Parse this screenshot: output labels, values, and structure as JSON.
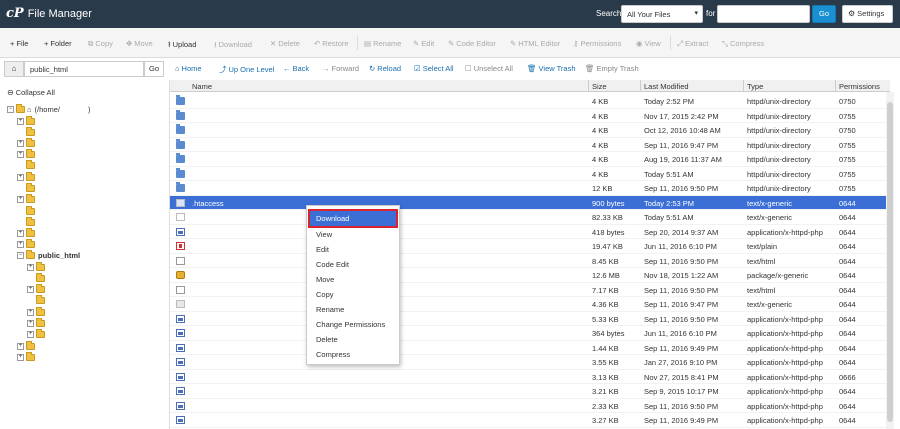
{
  "header": {
    "title": "File Manager",
    "logo": "cP",
    "search_label": "Search",
    "search_scope": "All Your Files",
    "for_label": "for",
    "search_value": "",
    "go_label": "Go",
    "settings_label": "Settings"
  },
  "toolbar": {
    "file": "File",
    "folder": "Folder",
    "copy": "Copy",
    "move": "Move",
    "upload": "Upload",
    "download": "Download",
    "delete": "Delete",
    "restore": "Restore",
    "rename": "Rename",
    "edit": "Edit",
    "code_editor": "Code Editor",
    "html_editor": "HTML Editor",
    "permissions": "Permissions",
    "view": "View",
    "extract": "Extract",
    "compress": "Compress"
  },
  "nav": {
    "path_value": "public_html",
    "go_label": "Go",
    "collapse_all": "Collapse All",
    "root_label": "(/home/",
    "root_suffix": ")",
    "public_html_label": "public_html"
  },
  "actionbar": {
    "home": "Home",
    "up_one_level": "Up One Level",
    "back": "Back",
    "forward": "Forward",
    "reload": "Reload",
    "select_all": "Select All",
    "unselect_all": "Unselect All",
    "view_trash": "View Trash",
    "empty_trash": "Empty Trash"
  },
  "table": {
    "columns": {
      "name": "Name",
      "size": "Size",
      "last_modified": "Last Modified",
      "type": "Type",
      "permissions": "Permissions"
    },
    "rows": [
      {
        "icon": "dir",
        "name": "",
        "size": "4 KB",
        "modified": "Today 2:52 PM",
        "type": "httpd/unix-directory",
        "perms": "0750"
      },
      {
        "icon": "dir",
        "name": "",
        "size": "4 KB",
        "modified": "Nov 17, 2015 2:42 PM",
        "type": "httpd/unix-directory",
        "perms": "0755"
      },
      {
        "icon": "dir",
        "name": "",
        "size": "4 KB",
        "modified": "Oct 12, 2016 10:48 AM",
        "type": "httpd/unix-directory",
        "perms": "0750"
      },
      {
        "icon": "dir",
        "name": "",
        "size": "4 KB",
        "modified": "Sep 11, 2016 9:47 PM",
        "type": "httpd/unix-directory",
        "perms": "0755"
      },
      {
        "icon": "dir",
        "name": "",
        "size": "4 KB",
        "modified": "Aug 19, 2016 11:37 AM",
        "type": "httpd/unix-directory",
        "perms": "0755"
      },
      {
        "icon": "dir",
        "name": "",
        "size": "4 KB",
        "modified": "Today 5:51 AM",
        "type": "httpd/unix-directory",
        "perms": "0755"
      },
      {
        "icon": "dir",
        "name": "",
        "size": "12 KB",
        "modified": "Sep 11, 2016 9:50 PM",
        "type": "httpd/unix-directory",
        "perms": "0755"
      },
      {
        "icon": "txt",
        "name": ".htaccess",
        "size": "900 bytes",
        "modified": "Today 2:53 PM",
        "type": "text/x-generic",
        "perms": "0644"
      },
      {
        "icon": "txt",
        "name": "",
        "size": "82.33 KB",
        "modified": "Today 5:51 AM",
        "type": "text/x-generic",
        "perms": "0644"
      },
      {
        "icon": "php",
        "name": "",
        "size": "418 bytes",
        "modified": "Sep 20, 2014 9:37 AM",
        "type": "application/x-httpd-php",
        "perms": "0644"
      },
      {
        "icon": "pdf",
        "name": "",
        "size": "19.47 KB",
        "modified": "Jun 11, 2016 6:10 PM",
        "type": "text/plain",
        "perms": "0644"
      },
      {
        "icon": "html",
        "name": "",
        "size": "8.45 KB",
        "modified": "Sep 11, 2016 9:50 PM",
        "type": "text/html",
        "perms": "0644"
      },
      {
        "icon": "pkg",
        "name": "",
        "size": "12.6 MB",
        "modified": "Nov 18, 2015 1:22 AM",
        "type": "package/x-generic",
        "perms": "0644"
      },
      {
        "icon": "html",
        "name": "",
        "size": "7.17 KB",
        "modified": "Sep 11, 2016 9:50 PM",
        "type": "text/html",
        "perms": "0644"
      },
      {
        "icon": "generic",
        "name": "",
        "size": "4.36 KB",
        "modified": "Sep 11, 2016 9:47 PM",
        "type": "text/x-generic",
        "perms": "0644"
      },
      {
        "icon": "php",
        "name": "",
        "size": "5.33 KB",
        "modified": "Sep 11, 2016 9:50 PM",
        "type": "application/x-httpd-php",
        "perms": "0644"
      },
      {
        "icon": "php",
        "name": "",
        "size": "364 bytes",
        "modified": "Jun 11, 2016 6:10 PM",
        "type": "application/x-httpd-php",
        "perms": "0644"
      },
      {
        "icon": "php",
        "name": "",
        "size": "1.44 KB",
        "modified": "Sep 11, 2016 9:49 PM",
        "type": "application/x-httpd-php",
        "perms": "0644"
      },
      {
        "icon": "php",
        "name": "",
        "size": "3.55 KB",
        "modified": "Jan 27, 2016 9:10 PM",
        "type": "application/x-httpd-php",
        "perms": "0644"
      },
      {
        "icon": "php",
        "name": "",
        "size": "3.13 KB",
        "modified": "Nov 27, 2015 8:41 PM",
        "type": "application/x-httpd-php",
        "perms": "0666"
      },
      {
        "icon": "php",
        "name": "",
        "size": "3.21 KB",
        "modified": "Sep 9, 2015 10:17 PM",
        "type": "application/x-httpd-php",
        "perms": "0644"
      },
      {
        "icon": "php",
        "name": "",
        "size": "2.33 KB",
        "modified": "Sep 11, 2016 9:50 PM",
        "type": "application/x-httpd-php",
        "perms": "0644"
      },
      {
        "icon": "php",
        "name": "",
        "size": "3.27 KB",
        "modified": "Sep 11, 2016 9:49 PM",
        "type": "application/x-httpd-php",
        "perms": "0644"
      }
    ]
  },
  "context_menu": {
    "items": [
      "Download",
      "View",
      "Edit",
      "Code Edit",
      "Move",
      "Copy",
      "Rename",
      "Change Permissions",
      "Delete",
      "Compress"
    ]
  },
  "colors": {
    "header_bg": "#293a4a",
    "selected_row": "#3b6fd6",
    "highlight_outline": "#d9232e",
    "link": "#1a6fb0"
  }
}
